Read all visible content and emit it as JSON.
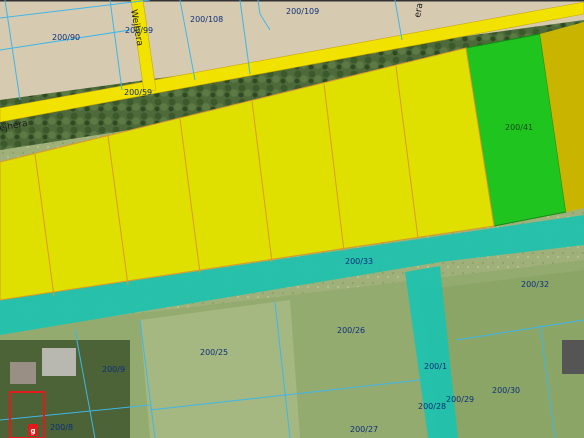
{
  "map": {
    "colors": {
      "selected_parcels": "#e0e000",
      "selected_parcels_stroke": "#d89a2a",
      "green_parcel": "#1fc41f",
      "right_field": "#c9b400",
      "road_parcel": "#19c3b0",
      "street": "#f2e200",
      "parcel_boundary": "#3fb6e8",
      "label": "#0d2f7a"
    },
    "streets": {
      "main_street_label_left": "ejhera",
      "main_street_label_right": "era",
      "side_street_label": "Wejhera"
    },
    "parcel_labels": {
      "p200_90": "200/90",
      "p200_99": "200/99",
      "p200_108": "200/108",
      "p200_109": "200/109",
      "p200_59": "200/59",
      "p200_41": "200/41",
      "p200_33": "200/33",
      "p200_32": "200/32",
      "p200_26": "200/26",
      "p200_25": "200/25",
      "p200_9": "200/9",
      "p200_1": "200/1",
      "p200_29": "200/29",
      "p200_28": "200/28",
      "p200_30": "200/30",
      "p200_8": "200/8",
      "p200_27": "200/27"
    },
    "building_marker": "g"
  }
}
